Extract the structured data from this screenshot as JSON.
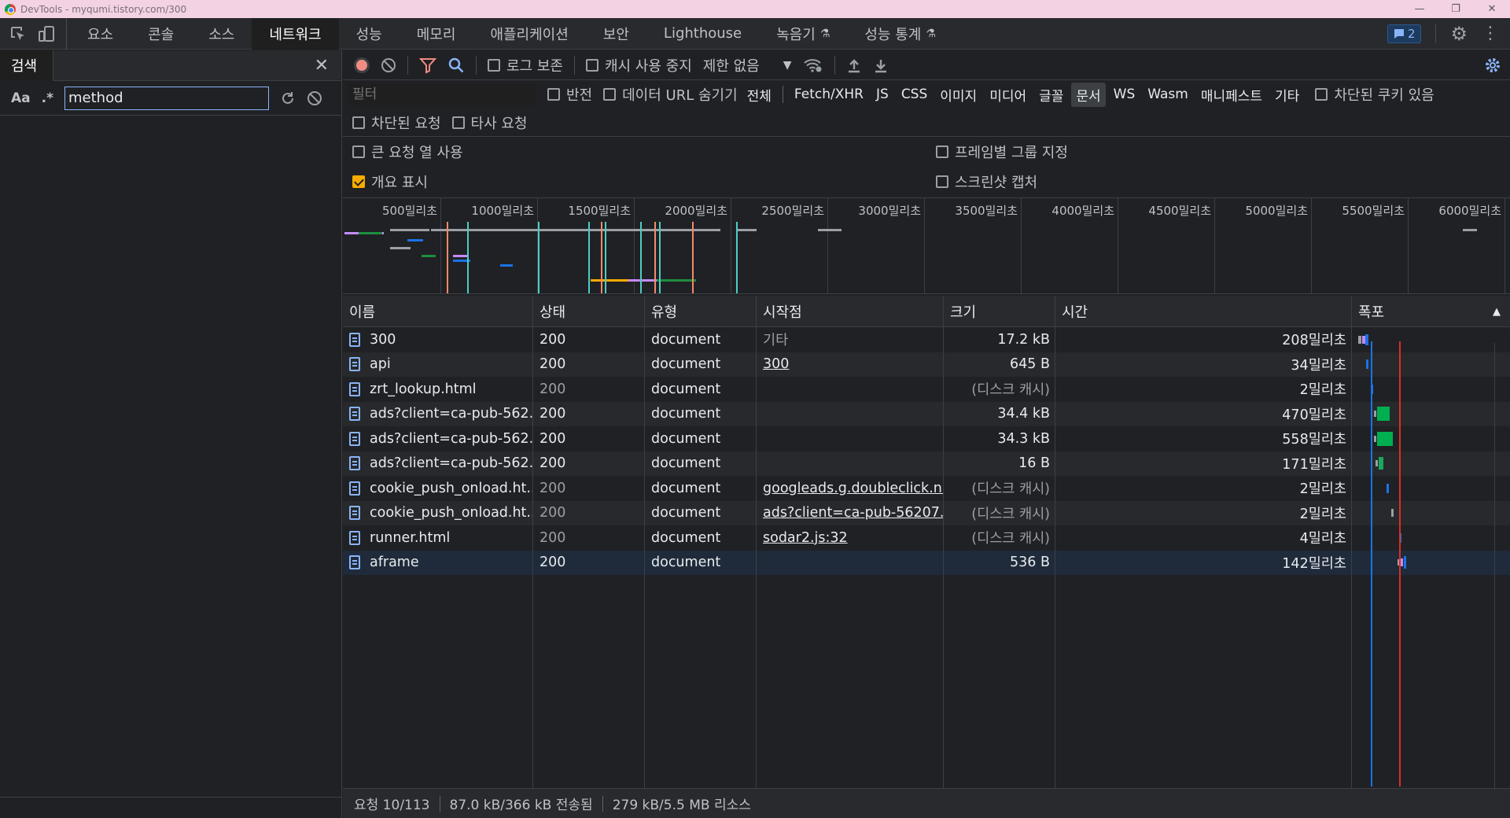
{
  "window": {
    "title": "DevTools - myqumi.tistory.com/300",
    "controls": [
      "—",
      "❐",
      "✕"
    ]
  },
  "main_tabs": [
    "요소",
    "콘솔",
    "소스",
    "네트워크",
    "성능",
    "메모리",
    "애플리케이션",
    "보안",
    "Lighthouse",
    "녹음기",
    "성능 통계"
  ],
  "issues_count": "2",
  "search_panel": {
    "tab_label": "검색",
    "case_label": "Aa",
    "regex_label": ".*",
    "query": "method"
  },
  "toolbar": {
    "preserve_log": "로그 보존",
    "disable_cache": "캐시 사용 중지",
    "throttling": "제한 없음"
  },
  "filter": {
    "placeholder": "필터",
    "invert": "반전",
    "hide_data_urls": "데이터 URL 숨기기",
    "types": [
      "전체",
      "Fetch/XHR",
      "JS",
      "CSS",
      "이미지",
      "미디어",
      "글꼴",
      "문서",
      "WS",
      "Wasm",
      "매니페스트",
      "기타"
    ],
    "active_type": "문서",
    "blocked_cookies": "차단된 쿠키 있음",
    "blocked_requests": "차단된 요청",
    "third_party": "타사 요청"
  },
  "settings": {
    "big_rows": "큰 요청 열 사용",
    "group_by_frame": "프레임별 그룹 지정",
    "show_overview": "개요 표시",
    "capture_screenshots": "스크린샷 캡처"
  },
  "overview_ticks": [
    "500밀리초",
    "1000밀리초",
    "1500밀리초",
    "2000밀리초",
    "2500밀리초",
    "3000밀리초",
    "3500밀리초",
    "4000밀리초",
    "4500밀리초",
    "5000밀리초",
    "5500밀리초",
    "6000밀리초"
  ],
  "table": {
    "headers": {
      "name": "이름",
      "status": "상태",
      "type": "유형",
      "initiator": "시작점",
      "size": "크기",
      "time": "시간",
      "waterfall": "폭포"
    },
    "rows": [
      {
        "name": "300",
        "status": "200",
        "type": "document",
        "initiator": "기타",
        "size": "17.2 kB",
        "time": "208밀리초"
      },
      {
        "name": "api",
        "status": "200",
        "type": "document",
        "initiator": "300",
        "size": "645 B",
        "time": "34밀리초"
      },
      {
        "name": "zrt_lookup.html",
        "status": "200",
        "type": "document",
        "initiator": "",
        "size": "(디스크 캐시)",
        "time": "2밀리초"
      },
      {
        "name": "ads?client=ca-pub-562...",
        "status": "200",
        "type": "document",
        "initiator": "",
        "size": "34.4 kB",
        "time": "470밀리초"
      },
      {
        "name": "ads?client=ca-pub-562...",
        "status": "200",
        "type": "document",
        "initiator": "",
        "size": "34.3 kB",
        "time": "558밀리초"
      },
      {
        "name": "ads?client=ca-pub-562...",
        "status": "200",
        "type": "document",
        "initiator": "",
        "size": "16 B",
        "time": "171밀리초"
      },
      {
        "name": "cookie_push_onload.ht...",
        "status": "200",
        "type": "document",
        "initiator": "googleads.g.doubleclick.n...",
        "size": "(디스크 캐시)",
        "time": "2밀리초"
      },
      {
        "name": "cookie_push_onload.ht...",
        "status": "200",
        "type": "document",
        "initiator": "ads?client=ca-pub-56207...",
        "size": "(디스크 캐시)",
        "time": "2밀리초"
      },
      {
        "name": "runner.html",
        "status": "200",
        "type": "document",
        "initiator": "sodar2.js:32",
        "size": "(디스크 캐시)",
        "time": "4밀리초"
      },
      {
        "name": "aframe",
        "status": "200",
        "type": "document",
        "initiator": "",
        "size": "536 B",
        "time": "142밀리초"
      }
    ]
  },
  "status_bar": {
    "requests": "요청 10/113",
    "transferred": "87.0 kB/366 kB 전송됨",
    "resources": "279 kB/5.5 MB 리소스"
  }
}
